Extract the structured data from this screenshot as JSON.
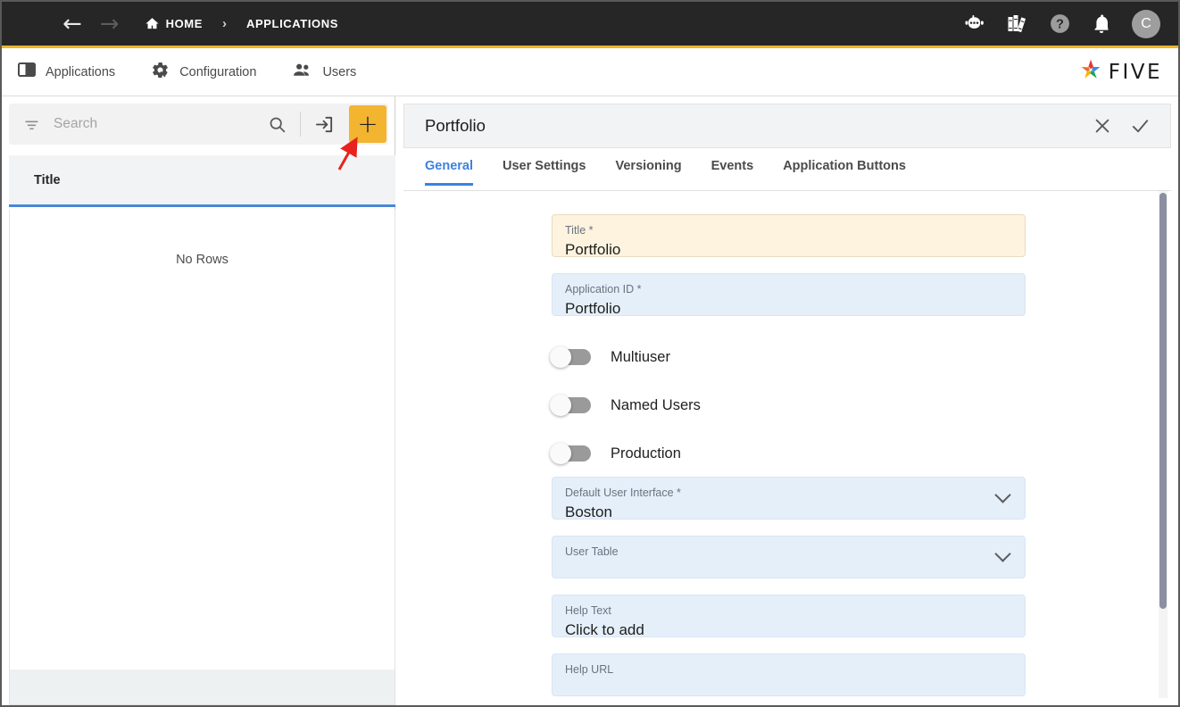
{
  "topbar": {
    "menu_icon": "hamburger-menu-icon",
    "back_icon": "arrow-back-icon",
    "forward_icon": "arrow-forward-icon",
    "home_icon": "home-icon",
    "breadcrumbs": [
      {
        "label": "HOME"
      },
      {
        "label": "APPLICATIONS"
      }
    ],
    "separator": "›",
    "actions": [
      {
        "name": "robot-assistant-icon"
      },
      {
        "name": "library-books-icon"
      },
      {
        "name": "help-icon"
      },
      {
        "name": "notifications-bell-icon"
      }
    ],
    "avatar_initial": "C",
    "accent_color": "#f0b429",
    "background_color": "#262626"
  },
  "modulebar": {
    "tabs": [
      {
        "label": "Applications",
        "icon": "applications-panel-icon"
      },
      {
        "label": "Configuration",
        "icon": "gear-settings-icon"
      },
      {
        "label": "Users",
        "icon": "users-group-icon"
      }
    ],
    "logo_text": "FIVE"
  },
  "sidebar": {
    "search": {
      "placeholder": "Search",
      "value": "",
      "filter_icon": "filter-icon",
      "search_icon": "search-icon",
      "import_icon": "import-icon",
      "add_icon": "plus-icon",
      "add_button_color": "#f3b52f"
    },
    "list": {
      "column_header": "Title",
      "header_underline_color": "#4a86d8",
      "empty_message": "No Rows"
    }
  },
  "detail": {
    "title": "Portfolio",
    "close_icon": "close-icon",
    "confirm_icon": "check-icon",
    "tabs": [
      {
        "label": "General",
        "active": true
      },
      {
        "label": "User Settings",
        "active": false
      },
      {
        "label": "Versioning",
        "active": false
      },
      {
        "label": "Events",
        "active": false
      },
      {
        "label": "Application Buttons",
        "active": false
      }
    ],
    "active_tab_color": "#3b82e0",
    "fields": [
      {
        "label": "Title *",
        "value": "Portfolio",
        "style": "beige",
        "type": "text"
      },
      {
        "label": "Application ID *",
        "value": "Portfolio",
        "style": "blue",
        "type": "text"
      },
      {
        "label": "Default User Interface *",
        "value": "Boston",
        "style": "blue",
        "type": "select"
      },
      {
        "label": "User Table",
        "value": "",
        "style": "blue",
        "type": "select"
      },
      {
        "label": "Help Text",
        "value": "Click to add",
        "style": "blue",
        "type": "text"
      },
      {
        "label": "Help URL",
        "value": "",
        "style": "blue",
        "type": "text"
      }
    ],
    "toggles": [
      {
        "label": "Multiuser",
        "on": false
      },
      {
        "label": "Named Users",
        "on": false
      },
      {
        "label": "Production",
        "on": false
      }
    ]
  },
  "annotation": {
    "arrow_color": "#e8231f",
    "points_to": "add-button"
  }
}
